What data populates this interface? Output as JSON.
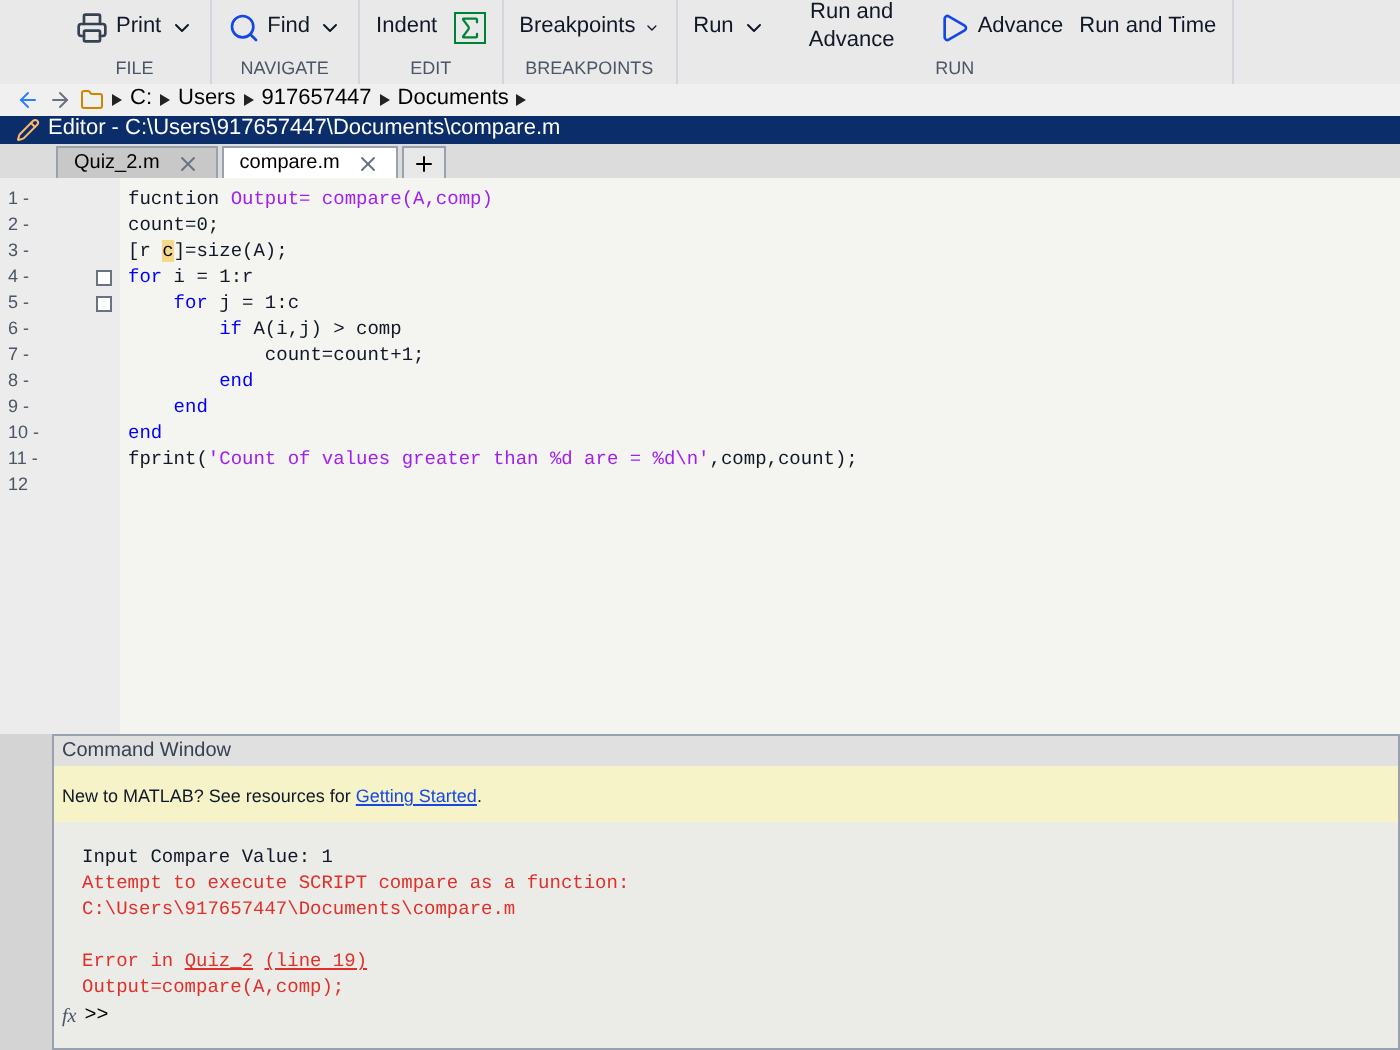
{
  "toolstrip": {
    "sections": [
      {
        "label": "FILE",
        "buttons": [
          {
            "label": "Print",
            "dropdown": true
          }
        ]
      },
      {
        "label": "NAVIGATE",
        "buttons": [
          {
            "label": "Find",
            "dropdown": true
          }
        ]
      },
      {
        "label": "EDIT",
        "buttons": [
          {
            "label": "Indent",
            "dropdown": false
          },
          {
            "dropdown": false
          }
        ]
      },
      {
        "label": "BREAKPOINTS",
        "buttons": [
          {
            "label": "Breakpoints",
            "dropdown": true
          }
        ]
      },
      {
        "label": "RUN",
        "buttons": [
          {
            "label": "Run",
            "dropdown": true
          },
          {
            "label": "Run and Advance",
            "dropdown": false
          },
          {
            "label": "Advance",
            "dropdown": false
          },
          {
            "label": "Run and Time",
            "dropdown": false
          }
        ]
      }
    ]
  },
  "address_bar": {
    "path": [
      "C:",
      "Users",
      "917657447",
      "Documents"
    ]
  },
  "editor": {
    "title": "Editor - C:\\Users\\917657447\\Documents\\compare.m",
    "tabs": [
      {
        "label": "Quiz_2.m",
        "selected": false
      },
      {
        "label": "compare.m",
        "selected": true
      }
    ],
    "lines": [
      {
        "number": "1 -",
        "fold": false,
        "segments": [
          {
            "kind": "plain",
            "text": "fucntion "
          },
          {
            "kind": "string",
            "text": "Output= compare(A,comp)"
          }
        ]
      },
      {
        "number": "2 -",
        "fold": false,
        "segments": [
          {
            "kind": "plain",
            "text": "count=0;"
          }
        ]
      },
      {
        "number": "3 -",
        "fold": false,
        "segments": [
          {
            "kind": "plain",
            "text": "[r "
          },
          {
            "kind": "highlight",
            "text": "c"
          },
          {
            "kind": "plain",
            "text": "]=size(A);"
          }
        ]
      },
      {
        "number": "4 -",
        "fold": true,
        "segments": [
          {
            "kind": "keyword",
            "text": "for"
          },
          {
            "kind": "plain",
            "text": " i = 1:r"
          }
        ]
      },
      {
        "number": "5 -",
        "fold": true,
        "segments": [
          {
            "kind": "keyword",
            "text": "    for"
          },
          {
            "kind": "plain",
            "text": " j = 1:c"
          }
        ]
      },
      {
        "number": "6 -",
        "fold": false,
        "segments": [
          {
            "kind": "keyword",
            "text": "        if"
          },
          {
            "kind": "plain",
            "text": " A(i,j) > comp"
          }
        ]
      },
      {
        "number": "7 -",
        "fold": false,
        "segments": [
          {
            "kind": "plain",
            "text": "            count=count+1;"
          }
        ]
      },
      {
        "number": "8 -",
        "fold": false,
        "segments": [
          {
            "kind": "keyword",
            "text": "        end"
          }
        ]
      },
      {
        "number": "9 -",
        "fold": false,
        "segments": [
          {
            "kind": "keyword",
            "text": "    end"
          }
        ]
      },
      {
        "number": "10 -",
        "fold": false,
        "segments": [
          {
            "kind": "keyword",
            "text": "end"
          }
        ]
      },
      {
        "number": "11 -",
        "fold": false,
        "segments": [
          {
            "kind": "plain",
            "text": "fprint("
          },
          {
            "kind": "string",
            "text": "'Count of values greater than %d are = %d\\n'"
          },
          {
            "kind": "plain",
            "text": ",comp,count);"
          }
        ]
      },
      {
        "number": "12",
        "fold": false
      }
    ]
  },
  "command_window": {
    "title": "Command Window",
    "banner": {
      "text": "New to MATLAB? See resources for ",
      "link": "Getting Started",
      "end": "."
    },
    "lines": [
      {
        "segments": [
          {
            "kind": "plain",
            "text": "Input Compare Value: 1"
          }
        ]
      },
      {
        "segments": [
          {
            "kind": "error",
            "text": "Attempt to execute SCRIPT compare as a function:"
          }
        ]
      },
      {
        "segments": [
          {
            "kind": "error",
            "text": "C:\\Users\\917657447\\Documents\\compare.m"
          }
        ]
      },
      {
        "segments": [
          {
            "kind": "error",
            "text": "Error in "
          },
          {
            "kind": "link",
            "text": "Quiz_2"
          },
          {
            "kind": "link",
            "text": "(line 19)"
          }
        ]
      },
      {
        "segments": [
          {
            "kind": "error",
            "text": "Output=compare(A,comp);"
          }
        ]
      }
    ],
    "fx_label": "fx",
    "prompt": ">>"
  }
}
